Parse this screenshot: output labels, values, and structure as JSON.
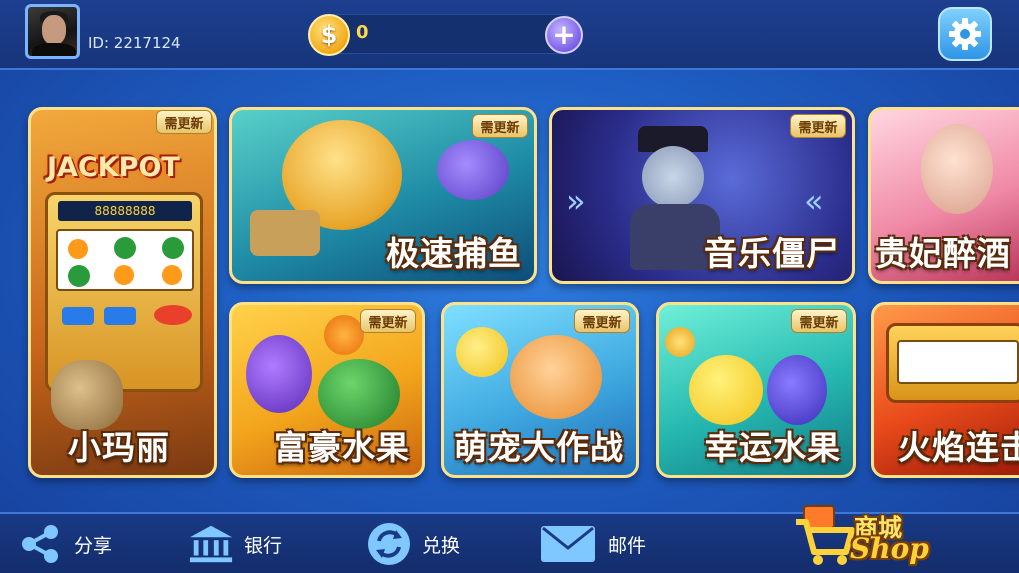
{
  "header": {
    "user_id": "ID: 2217124",
    "coin_value": "0",
    "coin_symbol": "$",
    "plus_symbol": "+"
  },
  "badge_text": "需更新",
  "games": [
    {
      "title": "小玛丽",
      "marquee": "JACKPOT",
      "reel_number": "88888888"
    },
    {
      "title": "极速捕鱼"
    },
    {
      "title": "音乐僵尸"
    },
    {
      "title": "贵妃醉酒"
    },
    {
      "title": "富豪水果"
    },
    {
      "title": "萌宠大作战"
    },
    {
      "title": "幸运水果"
    },
    {
      "title": "火焰连击"
    }
  ],
  "bottom_nav": [
    {
      "label": "分享",
      "icon": "share-icon"
    },
    {
      "label": "银行",
      "icon": "bank-icon"
    },
    {
      "label": "兑换",
      "icon": "exchange-icon"
    },
    {
      "label": "邮件",
      "icon": "mail-icon"
    }
  ],
  "shop": {
    "label": "商城",
    "sub": "Shop",
    "icon": "shopping-cart-icon"
  },
  "colors": {
    "card_border": "#ffe18a",
    "coin": "#ffd84a",
    "background": "#1f5fc4"
  }
}
